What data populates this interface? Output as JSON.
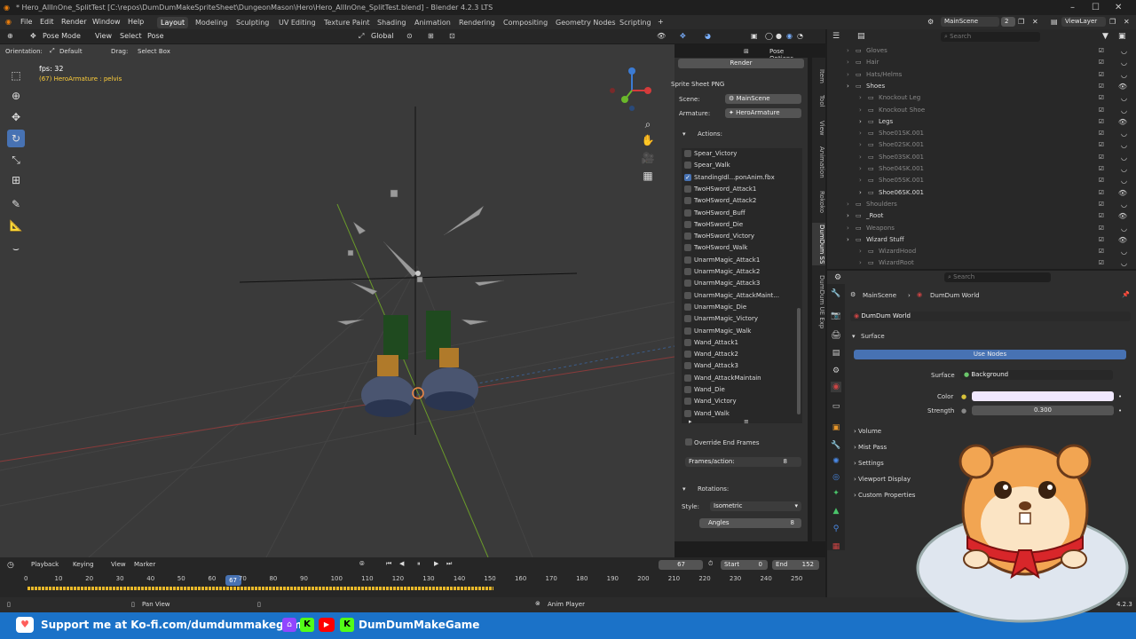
{
  "window": {
    "title": "* Hero_AllInOne_SplitTest [C:\\repos\\DumDumMakeSpriteSheet\\DungeonMason\\Hero\\Hero_AllInOne_SplitTest.blend] - Blender 4.2.3 LTS"
  },
  "menu": [
    "File",
    "Edit",
    "Render",
    "Window",
    "Help"
  ],
  "workspaces": [
    "Layout",
    "Modeling",
    "Sculpting",
    "UV Editing",
    "Texture Paint",
    "Shading",
    "Animation",
    "Rendering",
    "Compositing",
    "Geometry Nodes",
    "Scripting"
  ],
  "topright": {
    "scene": "MainScene",
    "scene_count": "2",
    "view_layer": "ViewLayer"
  },
  "viewport_header": {
    "mode": "Pose Mode",
    "menus": [
      "View",
      "Select",
      "Pose"
    ],
    "transform": "Global",
    "pose_options": "Pose Options"
  },
  "tool_header": {
    "orientation_label": "Orientation:",
    "orientation": "Default",
    "drag_label": "Drag:",
    "drag": "Select Box"
  },
  "viewport": {
    "fps": "fps: 32",
    "active": "(67) HeroArmature : pelvis"
  },
  "npanel": {
    "render_btn": "Render",
    "sprite_title": "Sprite Sheet PNG",
    "scene_label": "Scene:",
    "scene_value": "MainScene",
    "armature_label": "Armature:",
    "armature_value": "HeroArmature",
    "actions_title": "Actions:",
    "actions": [
      {
        "name": "Spear_Victory",
        "checked": false
      },
      {
        "name": "Spear_Walk",
        "checked": false
      },
      {
        "name": "StandingIdl...ponAnim.fbx",
        "checked": true
      },
      {
        "name": "TwoHSword_Attack1",
        "checked": false
      },
      {
        "name": "TwoHSword_Attack2",
        "checked": false
      },
      {
        "name": "TwoHSword_Buff",
        "checked": false
      },
      {
        "name": "TwoHSword_Die",
        "checked": false
      },
      {
        "name": "TwoHSword_Victory",
        "checked": false
      },
      {
        "name": "TwoHSword_Walk",
        "checked": false
      },
      {
        "name": "UnarmMagic_Attack1",
        "checked": false
      },
      {
        "name": "UnarmMagic_Attack2",
        "checked": false
      },
      {
        "name": "UnarmMagic_Attack3",
        "checked": false
      },
      {
        "name": "UnarmMagic_AttackMaint...",
        "checked": false
      },
      {
        "name": "UnarmMagic_Die",
        "checked": false
      },
      {
        "name": "UnarmMagic_Victory",
        "checked": false
      },
      {
        "name": "UnarmMagic_Walk",
        "checked": false
      },
      {
        "name": "Wand_Attack1",
        "checked": false
      },
      {
        "name": "Wand_Attack2",
        "checked": false
      },
      {
        "name": "Wand_Attack3",
        "checked": false
      },
      {
        "name": "Wand_AttackMaintain",
        "checked": false
      },
      {
        "name": "Wand_Die",
        "checked": false
      },
      {
        "name": "Wand_Victory",
        "checked": false
      },
      {
        "name": "Wand_Walk",
        "checked": false
      }
    ],
    "override_label": "Override End Frames",
    "frames_label": "Frames/action:",
    "frames_value": "8",
    "rotations_title": "Rotations:",
    "style_label": "Style:",
    "style_value": "Isometric",
    "angles_label": "Angles",
    "angles_value": "8"
  },
  "ntabs": [
    "Item",
    "Tool",
    "View",
    "Animation",
    "Rokoko",
    "DumDum SS",
    "DumDum UE Exp"
  ],
  "outliner": {
    "search_placeholder": "Search",
    "rows": [
      {
        "name": "Gloves",
        "dim": true,
        "indent": 1
      },
      {
        "name": "Hair",
        "dim": true,
        "indent": 1
      },
      {
        "name": "Hats/Helms",
        "dim": true,
        "indent": 1
      },
      {
        "name": "Shoes",
        "dim": false,
        "indent": 1
      },
      {
        "name": "Knockout Leg",
        "dim": true,
        "indent": 2
      },
      {
        "name": "Knockout Shoe",
        "dim": true,
        "indent": 2
      },
      {
        "name": "Legs",
        "dim": false,
        "indent": 2
      },
      {
        "name": "Shoe01SK.001",
        "dim": true,
        "indent": 2
      },
      {
        "name": "Shoe02SK.001",
        "dim": true,
        "indent": 2
      },
      {
        "name": "Shoe03SK.001",
        "dim": true,
        "indent": 2
      },
      {
        "name": "Shoe04SK.001",
        "dim": true,
        "indent": 2
      },
      {
        "name": "Shoe05SK.001",
        "dim": true,
        "indent": 2
      },
      {
        "name": "Shoe06SK.001",
        "dim": false,
        "indent": 2
      },
      {
        "name": "Shoulders",
        "dim": true,
        "indent": 1
      },
      {
        "name": "_Root",
        "dim": false,
        "indent": 1
      },
      {
        "name": "Weapons",
        "dim": true,
        "indent": 1
      },
      {
        "name": "Wizard Stuff",
        "dim": false,
        "indent": 1
      },
      {
        "name": "WizardHood",
        "dim": true,
        "indent": 2
      },
      {
        "name": "WizardRoot",
        "dim": true,
        "indent": 2
      }
    ]
  },
  "properties": {
    "search_placeholder": "Search",
    "breadcrumb_scene": "MainScene",
    "breadcrumb_world": "DumDum World",
    "world_name": "DumDum World",
    "surface_title": "Surface",
    "use_nodes": "Use Nodes",
    "surface_label": "Surface",
    "surface_value": "Background",
    "color_label": "Color",
    "color_value": "#f0e8ff",
    "strength_label": "Strength",
    "strength_value": "0.300",
    "sections": [
      "Volume",
      "Mist Pass",
      "Settings",
      "Viewport Display",
      "Custom Properties"
    ]
  },
  "timeline": {
    "menus": [
      "Playback",
      "Keying",
      "View",
      "Marker"
    ],
    "current_frame": "67",
    "start_label": "Start",
    "start_value": "0",
    "end_label": "End",
    "end_value": "152",
    "ticks": [
      "0",
      "10",
      "20",
      "30",
      "40",
      "50",
      "60",
      "70",
      "80",
      "90",
      "100",
      "110",
      "120",
      "130",
      "140",
      "150",
      "160",
      "170",
      "180",
      "190",
      "200",
      "210",
      "220",
      "230",
      "240",
      "250"
    ],
    "frame_min": 0,
    "frame_max": 250
  },
  "statusbar": {
    "pan_view": "Pan View",
    "anim_player": "Anim Player",
    "version": "4.2.3"
  },
  "banner": {
    "kofi": "Support me at Ko-fi.com/dumdummakegame",
    "channel": "DumDumMakeGame"
  }
}
